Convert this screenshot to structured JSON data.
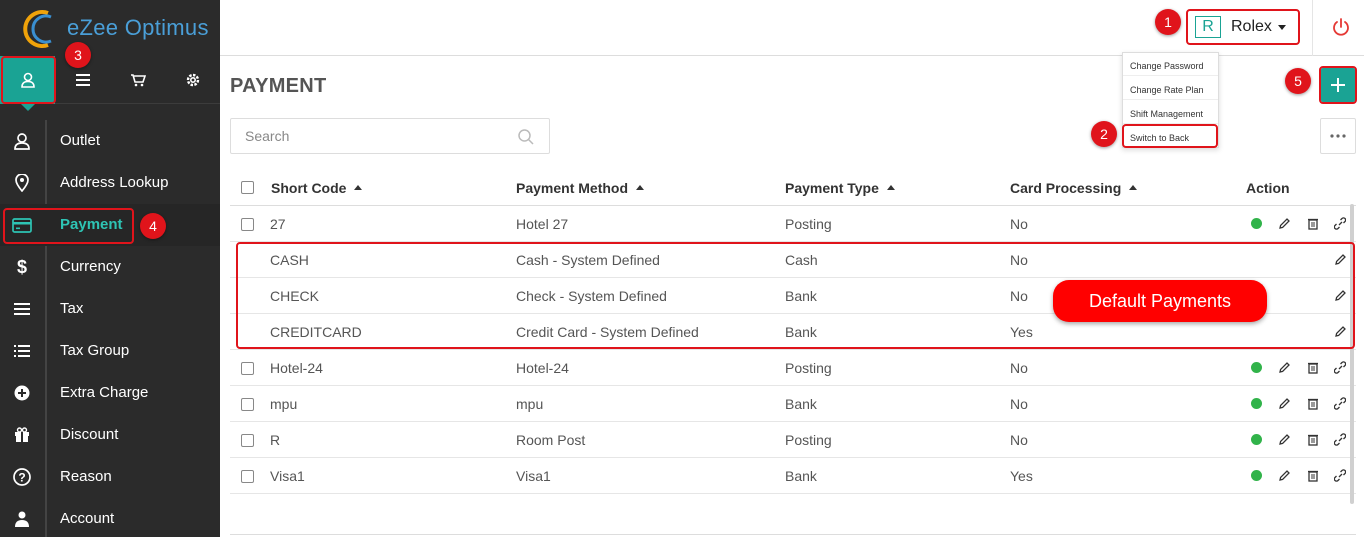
{
  "app": {
    "brand_name": "eZee Optimus",
    "accent_color": "#1aa394"
  },
  "sidebar": {
    "top_icons": [
      {
        "icon": "user-icon",
        "active": true
      },
      {
        "icon": "menu-icon",
        "active": false
      },
      {
        "icon": "cart-icon",
        "active": false
      },
      {
        "icon": "gear-icon",
        "active": false
      }
    ],
    "items": [
      {
        "label": "Outlet",
        "icon": "user-icon"
      },
      {
        "label": "Address Lookup",
        "icon": "location-pin-icon"
      },
      {
        "label": "Payment",
        "icon": "credit-card-icon",
        "active": true
      },
      {
        "label": "Currency",
        "icon": "dollar-icon"
      },
      {
        "label": "Tax",
        "icon": "list-icon"
      },
      {
        "label": "Tax Group",
        "icon": "bulleted-list-icon"
      },
      {
        "label": "Extra Charge",
        "icon": "plus-circle-icon"
      },
      {
        "label": "Discount",
        "icon": "gift-icon"
      },
      {
        "label": "Reason",
        "icon": "question-circle-icon"
      },
      {
        "label": "Account",
        "icon": "person-icon"
      }
    ]
  },
  "header": {
    "user_initial": "R",
    "user_name": "Rolex",
    "power_icon": "power-icon",
    "dropdown": [
      {
        "label": "Change Password"
      },
      {
        "label": "Change Rate Plan"
      },
      {
        "label": "Shift Management"
      },
      {
        "label": "Switch to Back"
      }
    ]
  },
  "main": {
    "title": "PAYMENT",
    "search": {
      "placeholder": "Search",
      "value": ""
    },
    "add_icon": "plus-icon",
    "more_icon": "ellipsis-icon"
  },
  "table": {
    "columns": [
      "Short Code",
      "Payment Method",
      "Payment Type",
      "Card Processing",
      "Action"
    ],
    "rows": [
      {
        "short_code": "27",
        "method": "Hotel 27",
        "type": "Posting",
        "card": "No",
        "default": false
      },
      {
        "short_code": "CASH",
        "method": "Cash - System Defined",
        "type": "Cash",
        "card": "No",
        "default": true
      },
      {
        "short_code": "CHECK",
        "method": "Check - System Defined",
        "type": "Bank",
        "card": "No",
        "default": true
      },
      {
        "short_code": "CREDITCARD",
        "method": "Credit Card - System Defined",
        "type": "Bank",
        "card": "Yes",
        "default": true
      },
      {
        "short_code": "Hotel-24",
        "method": "Hotel-24",
        "type": "Posting",
        "card": "No",
        "default": false
      },
      {
        "short_code": "mpu",
        "method": "mpu",
        "type": "Bank",
        "card": "No",
        "default": false
      },
      {
        "short_code": "R",
        "method": "Room Post",
        "type": "Posting",
        "card": "No",
        "default": false
      },
      {
        "short_code": "Visa1",
        "method": "Visa1",
        "type": "Bank",
        "card": "Yes",
        "default": false
      }
    ],
    "status_color": "#31b34a"
  },
  "annotations": {
    "badges": [
      "1",
      "2",
      "3",
      "4",
      "5"
    ],
    "callout": "Default Payments",
    "color": "#e0141b"
  }
}
